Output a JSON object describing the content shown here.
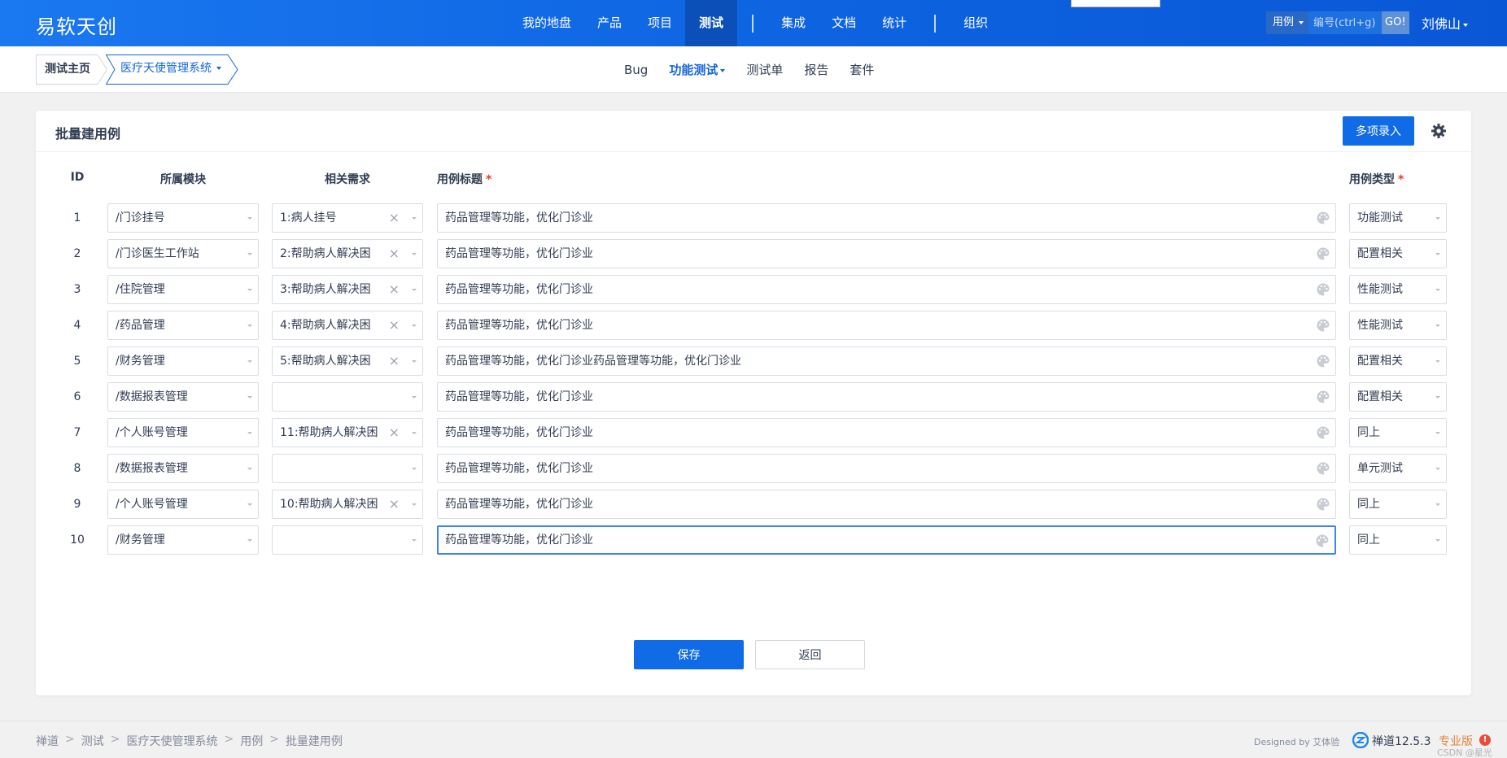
{
  "brand": "易软天创",
  "main_nav": [
    "我的地盘",
    "产品",
    "项目",
    "测试",
    "集成",
    "文档",
    "统计",
    "组织"
  ],
  "main_nav_active": "测试",
  "search": {
    "type": "用例",
    "placeholder": "编号(ctrl+g)",
    "go": "GO!"
  },
  "user": "刘佛山",
  "breadcrumb": {
    "home": "测试主页",
    "product": "医疗天使管理系统"
  },
  "sub_nav": [
    "Bug",
    "功能测试",
    "测试单",
    "报告",
    "套件"
  ],
  "sub_nav_active": "功能测试",
  "panel": {
    "title": "批量建用例",
    "multi_button": "多项录入",
    "headers": {
      "id": "ID",
      "module": "所属模块",
      "story": "相关需求",
      "title": "用例标题",
      "type": "用例类型"
    },
    "rows": [
      {
        "id": "1",
        "module": "/门诊挂号",
        "story": "1:病人挂号",
        "title": "药品管理等功能，优化门诊业",
        "type": "功能测试"
      },
      {
        "id": "2",
        "module": "/门诊医生工作站",
        "story": "2:帮助病人解决困",
        "title": "药品管理等功能，优化门诊业",
        "type": "配置相关"
      },
      {
        "id": "3",
        "module": "/住院管理",
        "story": "3:帮助病人解决困",
        "title": "药品管理等功能，优化门诊业",
        "type": "性能测试"
      },
      {
        "id": "4",
        "module": "/药品管理",
        "story": "4:帮助病人解决困",
        "title": "药品管理等功能，优化门诊业",
        "type": "性能测试"
      },
      {
        "id": "5",
        "module": "/财务管理",
        "story": "5:帮助病人解决困",
        "title": "药品管理等功能，优化门诊业药品管理等功能，优化门诊业",
        "type": "配置相关"
      },
      {
        "id": "6",
        "module": "/数据报表管理",
        "story": "",
        "title": "药品管理等功能，优化门诊业",
        "type": "配置相关"
      },
      {
        "id": "7",
        "module": "/个人账号管理",
        "story": "11:帮助病人解决困",
        "title": "药品管理等功能，优化门诊业",
        "type": "同上"
      },
      {
        "id": "8",
        "module": "/数据报表管理",
        "story": "",
        "title": "药品管理等功能，优化门诊业",
        "type": "单元测试"
      },
      {
        "id": "9",
        "module": "/个人账号管理",
        "story": "10:帮助病人解决困",
        "title": "药品管理等功能，优化门诊业",
        "type": "同上"
      },
      {
        "id": "10",
        "module": "/财务管理",
        "story": "",
        "title": "药品管理等功能，优化门诊业",
        "type": "同上"
      }
    ],
    "save": "保存",
    "back": "返回"
  },
  "footer": {
    "crumbs": [
      "禅道",
      "测试",
      "医疗天使管理系统",
      "用例",
      "批量建用例"
    ],
    "designed": "Designed by 艾体验",
    "version": "禅道12.5.3",
    "edition": "专业版",
    "watermark": "CSDN @星光"
  },
  "colors": {
    "nav_bg": "#1a78f0",
    "primary": "#0f6be6",
    "required": "#e53935",
    "edition": "#e0853a"
  }
}
